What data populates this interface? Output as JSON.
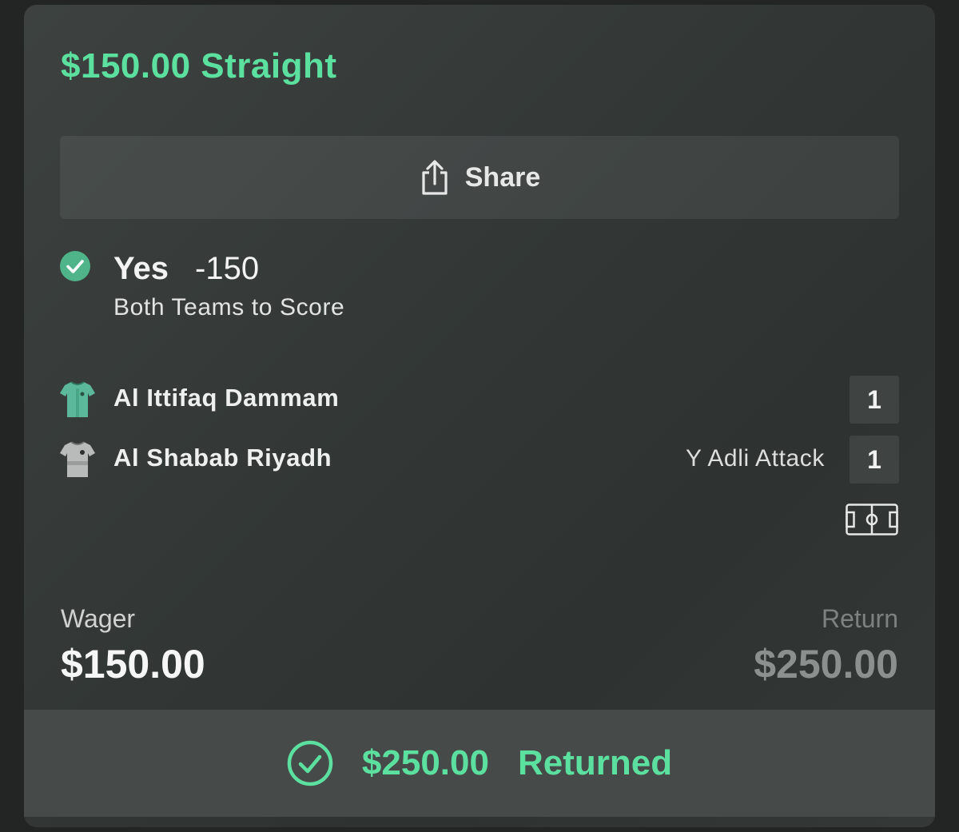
{
  "bet": {
    "title": "$150.00 Straight"
  },
  "share": {
    "label": "Share"
  },
  "selection": {
    "name": "Yes",
    "odds": "-150",
    "market": "Both Teams to Score"
  },
  "teams": [
    {
      "name": "Al Ittifaq Dammam",
      "score": "1",
      "event": "",
      "jersey_color": "#5bb89a"
    },
    {
      "name": "Al Shabab Riyadh",
      "score": "1",
      "event": "Y Adli Attack",
      "jersey_color": "#b8bbba"
    }
  ],
  "wager": {
    "label": "Wager",
    "value": "$150.00"
  },
  "return": {
    "label": "Return",
    "value": "$250.00"
  },
  "footer": {
    "amount": "$250.00",
    "status": "Returned"
  },
  "colors": {
    "accent": "#5ce0a0",
    "background": "#232524"
  },
  "icons": [
    "share-icon",
    "check-circle-icon",
    "jersey-icon",
    "pitch-icon",
    "returned-check-icon"
  ]
}
